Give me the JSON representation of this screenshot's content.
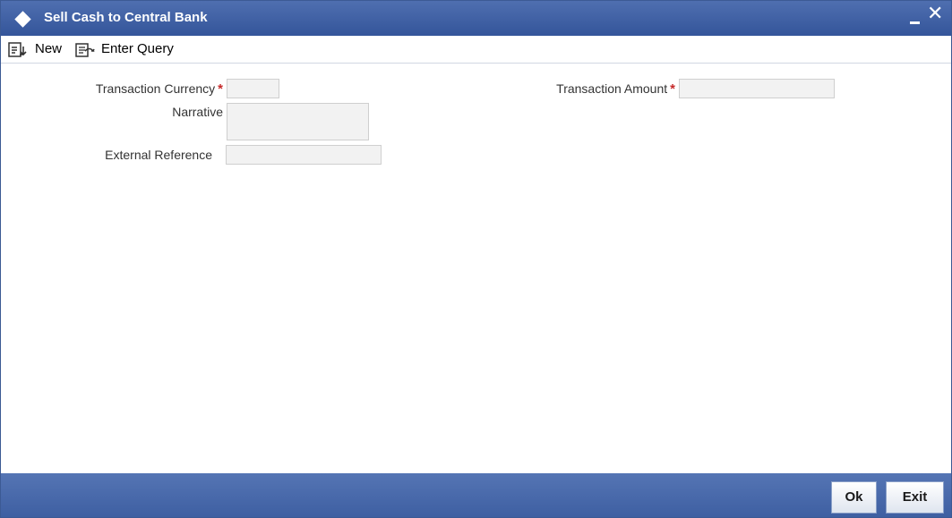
{
  "window": {
    "title": "Sell Cash to Central Bank",
    "icon": "diamond-icon",
    "minimize_icon": "minimize-icon",
    "close_icon": "close-icon"
  },
  "toolbar": {
    "new_label": "New",
    "new_icon": "new-document-icon",
    "enter_query_label": "Enter Query",
    "enter_query_icon": "query-icon"
  },
  "form": {
    "transaction_currency": {
      "label": "Transaction Currency",
      "required_mark": "*",
      "value": ""
    },
    "transaction_amount": {
      "label": "Transaction Amount",
      "required_mark": "*",
      "value": ""
    },
    "narrative": {
      "label": "Narrative",
      "value": ""
    },
    "external_reference": {
      "label": "External Reference",
      "value": ""
    }
  },
  "footer": {
    "ok_label": "Ok",
    "exit_label": "Exit"
  },
  "colors": {
    "titlebar": "#3e5fa2",
    "required": "#c62a2a",
    "input_bg": "#f2f2f2"
  }
}
